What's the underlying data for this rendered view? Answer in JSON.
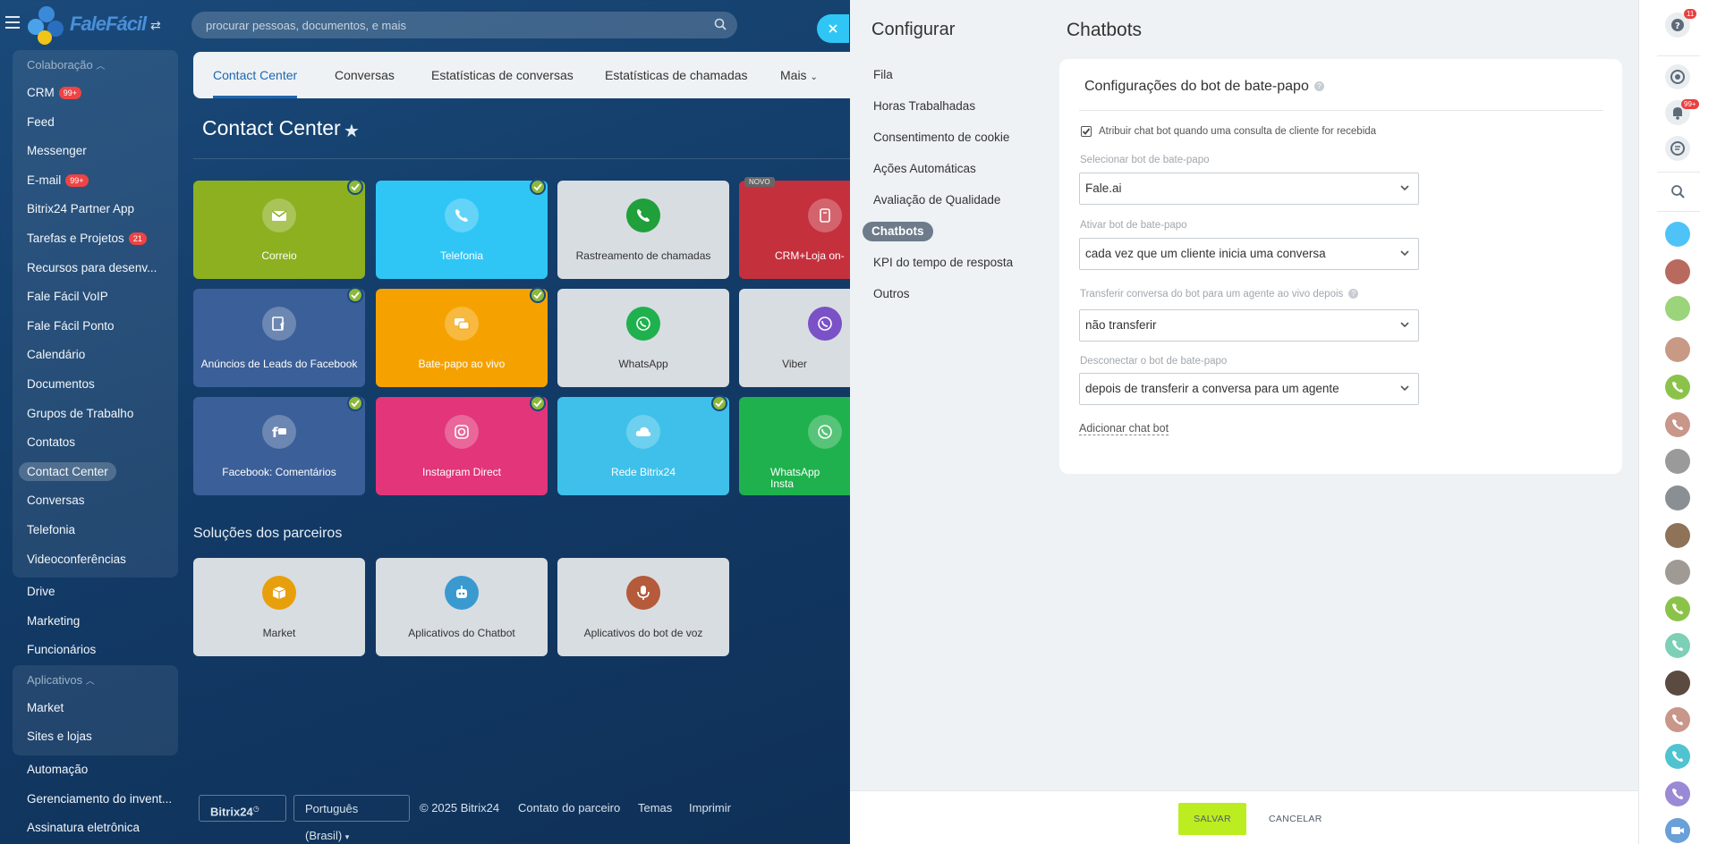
{
  "header": {
    "logo_text": "FaleFácil",
    "search_placeholder": "procurar pessoas, documentos, e mais"
  },
  "sidebar": {
    "group1_title": "Colaboração",
    "group1_items": [
      {
        "label": "CRM",
        "badge": "99+"
      },
      {
        "label": "Feed",
        "badge": ""
      },
      {
        "label": "Messenger",
        "badge": ""
      },
      {
        "label": "E-mail",
        "badge": "99+"
      },
      {
        "label": "Bitrix24 Partner App",
        "badge": ""
      },
      {
        "label": "Tarefas e Projetos",
        "badge": "21"
      },
      {
        "label": "Recursos para desenv...",
        "badge": ""
      },
      {
        "label": "Fale Fácil VoIP",
        "badge": ""
      },
      {
        "label": "Fale Fácil Ponto",
        "badge": ""
      },
      {
        "label": "Calendário",
        "badge": ""
      },
      {
        "label": "Documentos",
        "badge": ""
      },
      {
        "label": "Grupos de Trabalho",
        "badge": ""
      },
      {
        "label": "Contatos",
        "badge": ""
      },
      {
        "label": "Contact Center",
        "badge": ""
      },
      {
        "label": "Conversas",
        "badge": ""
      },
      {
        "label": "Telefonia",
        "badge": ""
      },
      {
        "label": "Videoconferências",
        "badge": ""
      }
    ],
    "mid_items": [
      "Drive",
      "Marketing",
      "Funcionários"
    ],
    "group2_title": "Aplicativos",
    "group2_items": [
      "Market",
      "Sites e lojas"
    ],
    "bottom_items": [
      "Automação",
      "Gerenciamento do invent...",
      "Assinatura eletrônica"
    ]
  },
  "main": {
    "tabs": [
      "Contact Center",
      "Conversas",
      "Estatísticas de conversas",
      "Estatísticas de chamadas",
      "Mais"
    ],
    "page_title": "Contact Center",
    "tiles": [
      {
        "label": "Correio",
        "color": "#8cb020"
      },
      {
        "label": "Telefonia",
        "color": "#2fc6f6"
      },
      {
        "label": "Rastreamento de chamadas",
        "color": "#d8dde2"
      },
      {
        "label": "CRM+Loja on-",
        "color": "#c5303d"
      },
      {
        "label": "Anúncios de Leads do Facebook",
        "color": "#3b5f98"
      },
      {
        "label": "Bate-papo ao vivo",
        "color": "#f5a200"
      },
      {
        "label": "WhatsApp",
        "color": "#d8dde2"
      },
      {
        "label": "Viber",
        "color": "#d8dde2"
      },
      {
        "label": "Facebook: Comentários",
        "color": "#3b5f98"
      },
      {
        "label": "Instagram Direct",
        "color": "#e2357a"
      },
      {
        "label": "Rede Bitrix24",
        "color": "#3ec0ea"
      },
      {
        "label": "WhatsApp Insta",
        "color": "#1fb14d"
      }
    ],
    "novo_label": "NOVO",
    "partners_title": "Soluções dos parceiros",
    "partner_tiles": [
      "Market",
      "Aplicativos do Chatbot",
      "Aplicativos do bot de voz"
    ]
  },
  "footer": {
    "brand": "Bitrix24",
    "language": "Português (Brasil)",
    "copyright": "© 2025 Bitrix24",
    "partner": "Contato do parceiro",
    "themes": "Temas",
    "print": "Imprimir"
  },
  "panel": {
    "left_title": "Configurar",
    "menu": [
      "Fila",
      "Horas Trabalhadas",
      "Consentimento de cookie",
      "Ações Automáticas",
      "Avaliação de Qualidade",
      "Chatbots",
      "KPI do tempo de resposta",
      "Outros"
    ],
    "main_title": "Chatbots",
    "card_title": "Configurações do bot de bate-papo",
    "checkbox_label": "Atribuir chat bot quando uma consulta de cliente for recebida",
    "fields": [
      {
        "label": "Selecionar bot de bate-papo",
        "value": "Fale.ai"
      },
      {
        "label": "Ativar bot de bate-papo",
        "value": "cada vez que um cliente inicia uma conversa"
      },
      {
        "label": "Transferir conversa do bot para um agente ao vivo depois",
        "value": "não transferir"
      },
      {
        "label": "Desconectar o bot de bate-papo",
        "value": "depois de transferir a conversa para um agente"
      }
    ],
    "add_link": "Adicionar chat bot",
    "save": "SALVAR",
    "cancel": "CANCELAR"
  },
  "rightbar": {
    "help_badge": "11",
    "notif_badge": "99+"
  }
}
